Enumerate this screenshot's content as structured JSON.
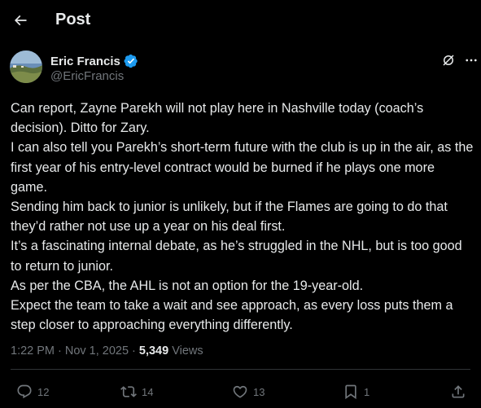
{
  "header": {
    "title": "Post",
    "back_icon": "arrow-left-icon"
  },
  "author": {
    "display_name": "Eric Francis",
    "handle": "@EricFrancis",
    "verified_color": "#1d9bf0"
  },
  "tweet": {
    "paragraphs": [
      "Can report, Zayne Parekh will not play here in Nashville today (coach’s decision). Ditto for Zary.",
      "I can also tell you Parekh’s short-term future with the club is up in the air, as the first year of his entry-level contract would be burned if he plays one more game.",
      "Sending him back to junior is unlikely, but if the Flames are going to do that they’d rather not use up a year on his deal first.",
      "It’s a fascinating internal debate, as he’s struggled in the NHL, but is too good to return to junior.",
      "As per the CBA, the AHL is not an option for the 19-year-old.",
      "Expect the team to take a wait and see approach, as every loss puts them a step closer to approaching everything differently."
    ]
  },
  "meta": {
    "time": "1:22 PM",
    "separator": "·",
    "date": "Nov 1, 2025",
    "views_count": "5,349",
    "views_label": "Views"
  },
  "actions": {
    "replies": "12",
    "reposts": "14",
    "likes": "13",
    "bookmarks": "1"
  },
  "colors": {
    "background": "#000000",
    "text": "#e7e9ea",
    "muted": "#71767b",
    "border": "#2f3336"
  }
}
